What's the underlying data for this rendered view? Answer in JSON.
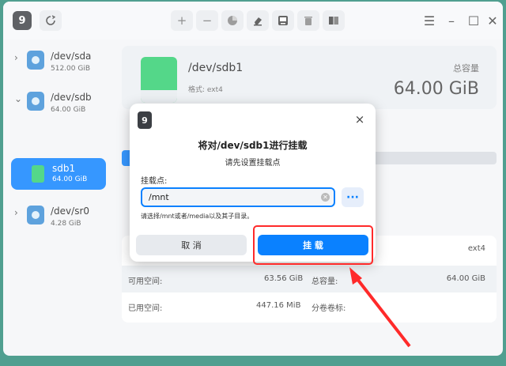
{
  "window": {
    "app_icon_glyph": "9",
    "toolbar_icons": [
      "plus-icon",
      "minus-icon",
      "pie-icon",
      "eraser-icon",
      "disk-icon",
      "trash-icon",
      "book-icon"
    ],
    "window_controls": [
      "menu-icon",
      "minimize-icon",
      "maximize-icon",
      "close-icon"
    ]
  },
  "sidebar": {
    "devices": [
      {
        "name": "/dev/sda",
        "size": "512.00 GiB"
      },
      {
        "name": "/dev/sdb",
        "size": "64.00 GiB"
      },
      {
        "name": "/dev/sr0",
        "size": "4.28 GiB"
      }
    ],
    "partition": {
      "name": "sdb1",
      "size": "64.00 GiB"
    }
  },
  "main": {
    "device": "/dev/sdb1",
    "format": "格式: ext4",
    "capacity_label": "总容量",
    "capacity_value": "64.00 GiB",
    "usage_fraction": 0.01,
    "table": {
      "row1": {
        "right_value": "ext4"
      },
      "row2": {
        "left_label": "可用空间:",
        "left_value": "63.56 GiB",
        "right_label": "总容量:",
        "right_value": "64.00 GiB"
      },
      "row3": {
        "left_label": "已用空间:",
        "left_value": "447.16 MiB",
        "right_label": "分卷卷标:",
        "right_value": ""
      }
    }
  },
  "dialog": {
    "icon_glyph": "9",
    "close_glyph": "×",
    "title": "将对/dev/sdb1进行挂载",
    "subtitle": "请先设置挂载点",
    "mount_point_label": "挂载点:",
    "mount_point_value": "/mnt",
    "hint": "请选择/mnt或者/media以及其子目录。",
    "cancel": "取 消",
    "mount": "挂 载"
  },
  "colors": {
    "accent": "#0a81ff",
    "partition_green": "#2fcf6f",
    "highlight_red": "#ff2a2a"
  }
}
